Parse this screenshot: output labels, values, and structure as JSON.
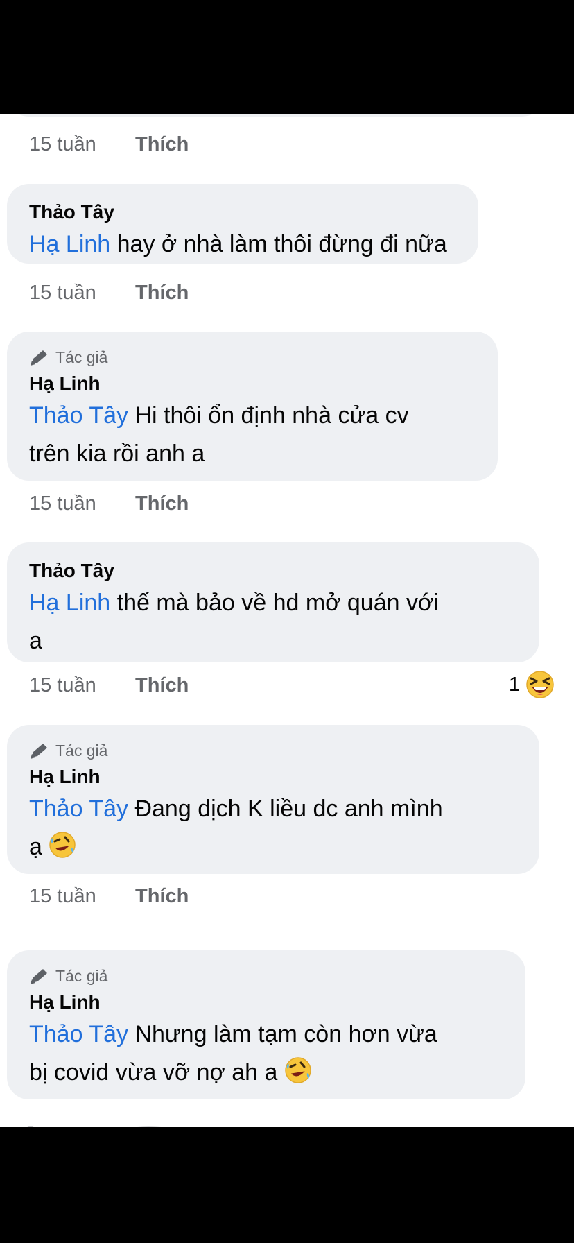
{
  "comments": [
    {
      "time": "15 tuần",
      "like": "Thích"
    },
    {
      "name": "Thảo Tây",
      "mention": "Hạ Linh",
      "text": " hay ở nhà làm thôi đừng đi nữa",
      "time": "15 tuần",
      "like": "Thích"
    },
    {
      "badge": "Tác giả",
      "name": "Hạ Linh",
      "mention": "Thảo Tây",
      "line1": " Hi thôi ổn định nhà cửa cv",
      "line2": "trên kia rồi anh a",
      "time": "15 tuần",
      "like": "Thích"
    },
    {
      "name": "Thảo Tây",
      "mention": "Hạ Linh",
      "line1": " thế mà bảo về hd mở quán với",
      "line2": "a",
      "time": "15 tuần",
      "like": "Thích",
      "reaction_count": "1",
      "reaction_icon": "laughing-squint-emoji"
    },
    {
      "badge": "Tác giả",
      "name": "Hạ Linh",
      "mention": "Thảo Tây",
      "line1": " Đang dịch K liều dc anh mình",
      "line2": "ạ ",
      "emoji": "rolling-on-floor-laughing-emoji",
      "time": "15 tuần",
      "like": "Thích"
    },
    {
      "badge": "Tác giả",
      "name": "Hạ Linh",
      "mention": "Thảo Tây",
      "line1": " Nhưng làm tạm còn hơn vừa",
      "line2": "bị covid vừa vỡ nợ ah a ",
      "emoji": "rolling-on-floor-laughing-emoji"
    }
  ],
  "colors": {
    "bubble": "#eef0f3",
    "mention": "#216fdb",
    "meta": "#65676b",
    "text": "#050505"
  }
}
